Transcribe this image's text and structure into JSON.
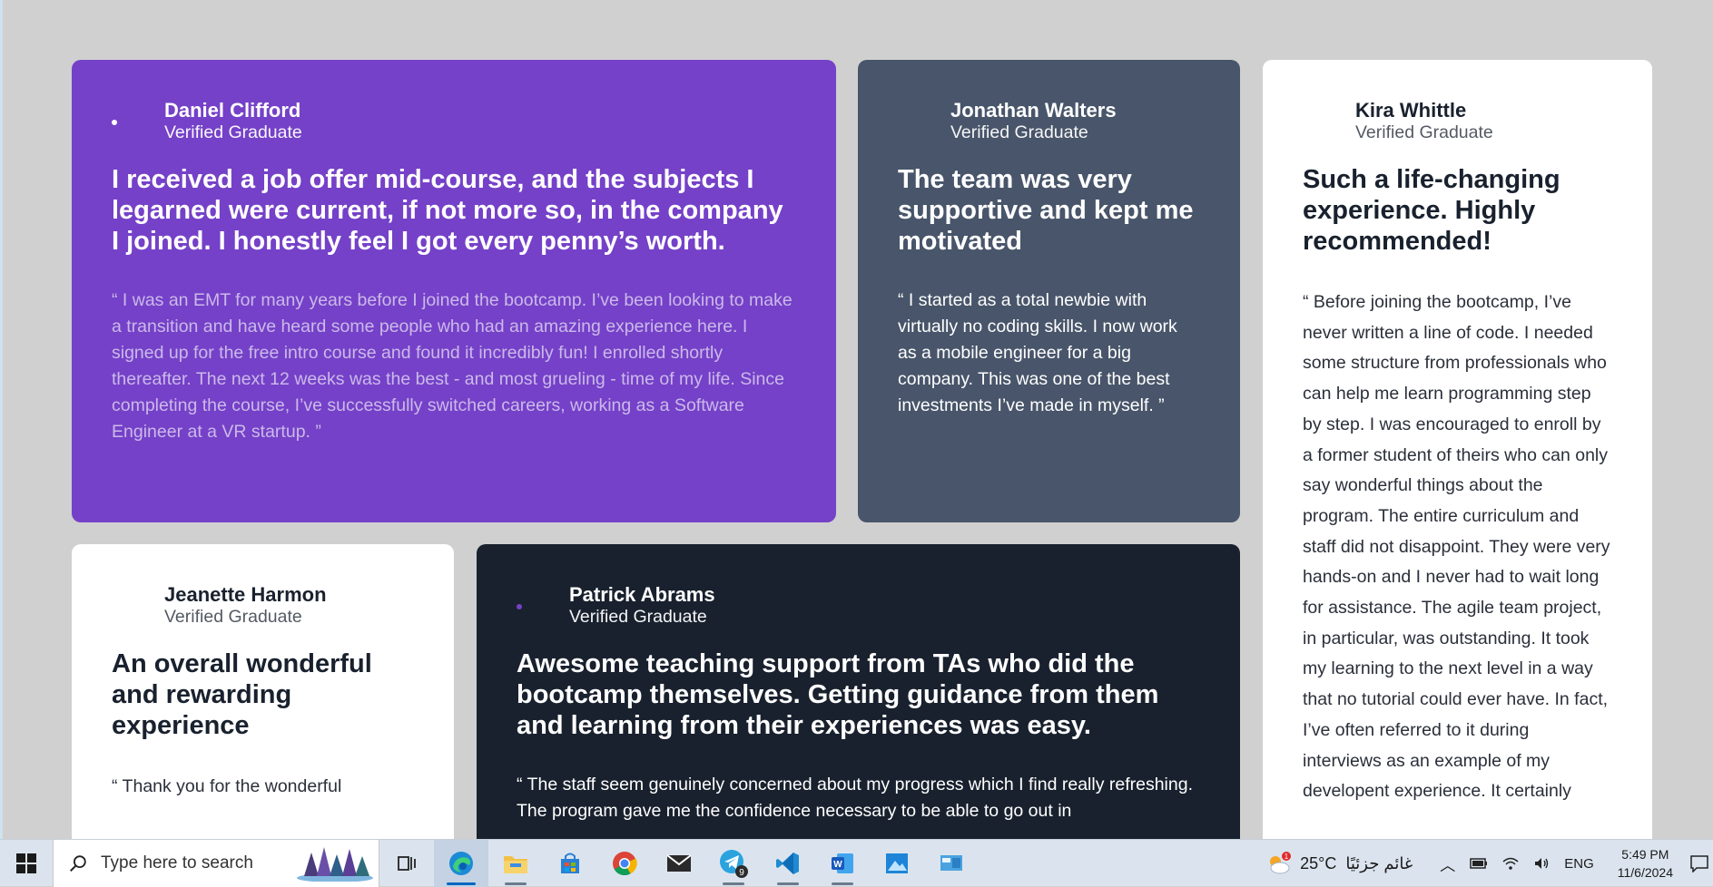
{
  "testimonials": [
    {
      "name": "Daniel Clifford",
      "role": "Verified Graduate",
      "headline": "I received a job offer mid-course, and the subjects I legarned were current, if not more so, in the company I joined. I honestly feel I got every penny’s worth.",
      "quote": "“ I was an EMT for many years before I joined the bootcamp. I’ve been looking to make a transition and have heard some people who had an amazing experience here. I signed up for the free intro course and found it incredibly fun! I enrolled shortly thereafter. The next 12 weeks was the best - and most grueling - time of my life. Since completing the course, I’ve successfully switched careers, working as a Software Engineer at a VR startup. ”"
    },
    {
      "name": "Jonathan Walters",
      "role": "Verified Graduate",
      "headline": "The team was very supportive and kept me motivated",
      "quote": "“ I started as a total newbie with virtually no coding skills. I now work as a mobile engineer for a big company. This was one of the best investments I’ve made in myself. ”"
    },
    {
      "name": "Kira Whittle",
      "role": "Verified Graduate",
      "headline": "Such a life-changing experience. Highly recommended!",
      "quote": "“ Before joining the bootcamp, I’ve never written a line of code. I needed some structure from professionals who can help me learn programming step by step. I was encouraged to enroll by a former student of theirs who can only say wonderful things about the program. The entire curriculum and staff did not disappoint. They were very hands-on and I never had to wait long for assistance. The agile team project, in particular, was outstanding. It took my learning to the next level in a way that no tutorial could ever have. In fact, I’ve often referred to it during interviews as an example of my developent experience. It certainly"
    },
    {
      "name": "Jeanette Harmon",
      "role": "Verified Graduate",
      "headline": "An overall wonderful and rewarding experience",
      "quote": "“ Thank you for the wonderful"
    },
    {
      "name": "Patrick Abrams",
      "role": "Verified Graduate",
      "headline": "Awesome teaching support from TAs who did the bootcamp themselves. Getting guidance from them and learning from their experiences was easy.",
      "quote": "“ The staff seem genuinely concerned about my progress which I find really refreshing. The program gave me the confidence necessary to be able to go out in"
    }
  ],
  "taskbar": {
    "search_placeholder": "Type here to search",
    "telegram_badge": "9",
    "weather_badge": "1",
    "temperature": "25°C",
    "weather_text": "غائم جزئيًا",
    "language": "ENG",
    "time": "5:49 PM",
    "date": "11/6/2024",
    "icons": [
      "task-view-icon",
      "edge-icon",
      "file-explorer-icon",
      "store-icon",
      "chrome-icon",
      "mail-icon",
      "telegram-icon",
      "vscode-icon",
      "word-icon",
      "photos-icon",
      "control-panel-icon"
    ]
  },
  "colors": {
    "purple": "#7541c8",
    "slate": "#48556a",
    "dark": "#19212e",
    "white": "#ffffff",
    "background": "#d0d0d0"
  }
}
